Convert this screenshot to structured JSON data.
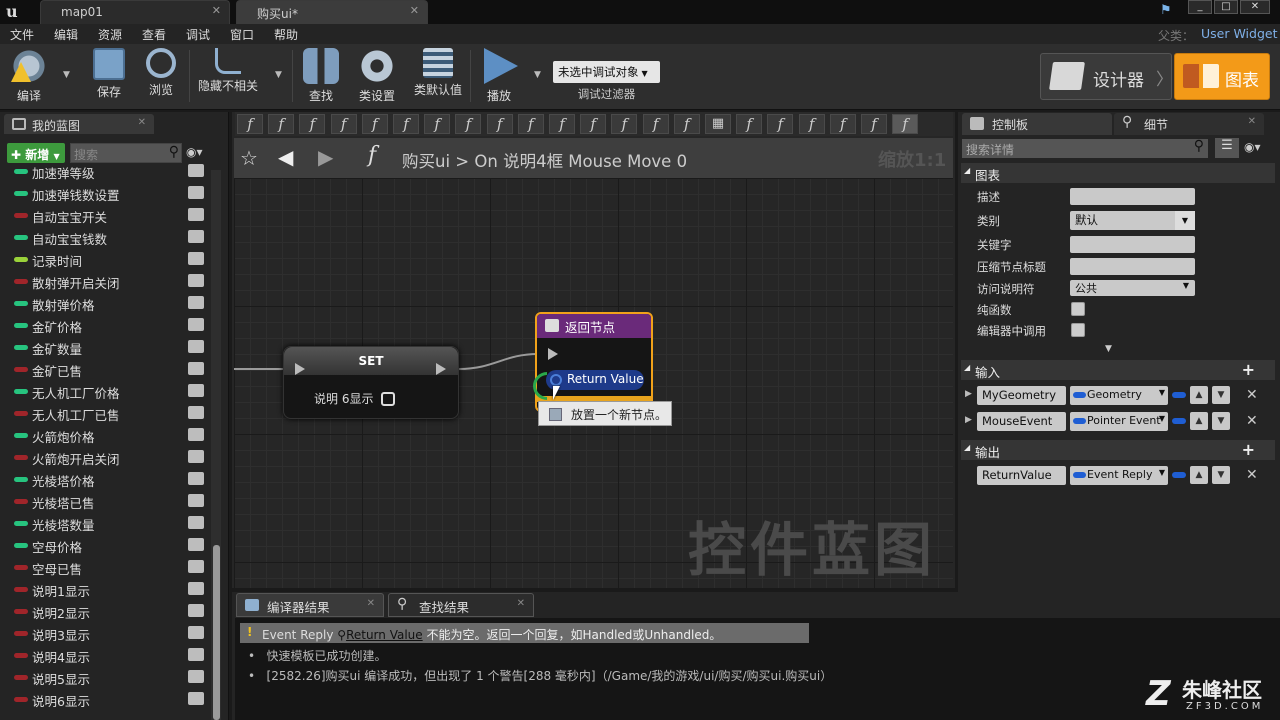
{
  "tabs": [
    {
      "label": "map01"
    },
    {
      "label": "购买ui*"
    }
  ],
  "parent": {
    "label": "父类：",
    "value": "User Widget"
  },
  "menu": [
    "文件",
    "编辑",
    "资源",
    "查看",
    "调试",
    "窗口",
    "帮助"
  ],
  "toolbar": {
    "compile": "编译",
    "save": "保存",
    "browse": "浏览",
    "hide": "隐藏不相关",
    "find": "查找",
    "class_settings": "类设置",
    "class_defaults": "类默认值",
    "play": "播放",
    "debug_select": "未选中调试对象",
    "debug_filter": "调试过滤器",
    "designer": "设计器",
    "graph": "图表"
  },
  "mybp": {
    "title": "我的蓝图",
    "new": "新增",
    "search_ph": "搜索",
    "vars": [
      {
        "name": "加速弹等级",
        "color": "#27c47f"
      },
      {
        "name": "加速弹钱数设置",
        "color": "#27c47f"
      },
      {
        "name": "自动宝宝开关",
        "color": "#a0252a"
      },
      {
        "name": "自动宝宝钱数",
        "color": "#27c47f"
      },
      {
        "name": "记录时间",
        "color": "#9ad23a"
      },
      {
        "name": "散射弹开启关闭",
        "color": "#a0252a"
      },
      {
        "name": "散射弹价格",
        "color": "#27c47f"
      },
      {
        "name": "金矿价格",
        "color": "#27c47f"
      },
      {
        "name": "金矿数量",
        "color": "#27c47f"
      },
      {
        "name": "金矿已售",
        "color": "#a0252a"
      },
      {
        "name": "无人机工厂价格",
        "color": "#27c47f"
      },
      {
        "name": "无人机工厂已售",
        "color": "#a0252a"
      },
      {
        "name": "火箭炮价格",
        "color": "#27c47f"
      },
      {
        "name": "火箭炮开启关闭",
        "color": "#a0252a"
      },
      {
        "name": "光棱塔价格",
        "color": "#27c47f"
      },
      {
        "name": "光棱塔已售",
        "color": "#a0252a"
      },
      {
        "name": "光棱塔数量",
        "color": "#27c47f"
      },
      {
        "name": "空母价格",
        "color": "#27c47f"
      },
      {
        "name": "空母已售",
        "color": "#a0252a"
      },
      {
        "name": "说明1显示",
        "color": "#a0252a"
      },
      {
        "name": "说明2显示",
        "color": "#a0252a"
      },
      {
        "name": "说明3显示",
        "color": "#a0252a"
      },
      {
        "name": "说明4显示",
        "color": "#a0252a"
      },
      {
        "name": "说明5显示",
        "color": "#a0252a"
      },
      {
        "name": "说明6显示",
        "color": "#a0252a"
      }
    ]
  },
  "graph": {
    "crumb_root": "购买ui",
    "crumb_sep": ">",
    "crumb_fn": "On 说明4框 Mouse Move 0",
    "zoom": "缩放1:1",
    "watermark": "控件蓝图",
    "set_node": {
      "title": "SET",
      "pin": "说明 6显示"
    },
    "return_node": {
      "title": "返回节点",
      "pin": "Return Value"
    },
    "tooltip": "放置一个新节点。"
  },
  "bottom": {
    "tab_compiler": "编译器结果",
    "tab_find": "查找结果",
    "warn_type": "Event Reply",
    "warn_pin": "Return Value",
    "warn_msg": "不能为空。返回一个回复，如Handled或Unhandled。",
    "line1": "快速模板已成功创建。",
    "line2": "[2582.26]购买ui 编译成功，但出现了 1 个警告[288 毫秒内]（/Game/我的游戏/ui/购买/购买ui.购买ui）"
  },
  "details": {
    "tab_palette": "控制板",
    "tab_details": "细节",
    "search_ph": "搜索详情",
    "graph_section": "图表",
    "props": [
      {
        "label": "描述",
        "value": ""
      },
      {
        "label": "类别",
        "value": "默认"
      },
      {
        "label": "关键字",
        "value": ""
      },
      {
        "label": "压缩节点标题",
        "value": ""
      },
      {
        "label": "访问说明符",
        "value": "公共"
      }
    ],
    "pure_label": "纯函数",
    "editor_call_label": "编辑器中调用",
    "inputs_section": "输入",
    "outputs_section": "输出",
    "inputs": [
      {
        "name": "MyGeometry",
        "type": "Geometry"
      },
      {
        "name": "MouseEvent",
        "type": "Pointer Event"
      }
    ],
    "outputs": [
      {
        "name": "ReturnValue",
        "type": "Event Reply"
      }
    ]
  },
  "brand": {
    "name": "朱峰社区",
    "url": "ZF3D.COM"
  }
}
